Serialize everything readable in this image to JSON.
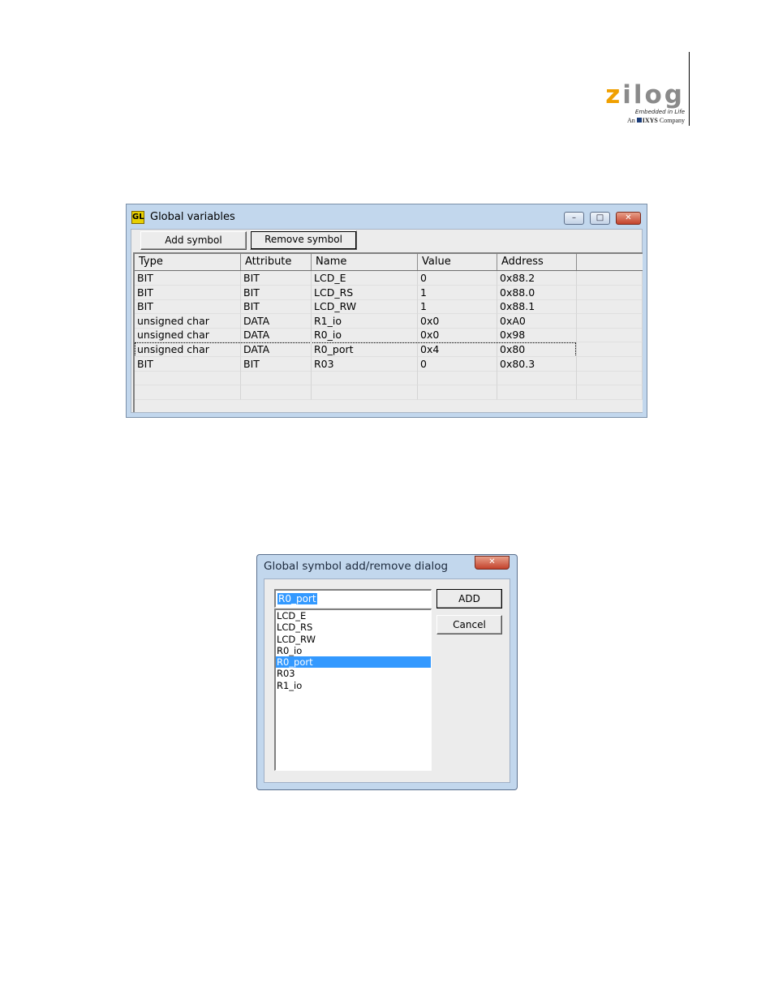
{
  "logo": {
    "brand": "zilog",
    "tagline": "Embedded in Life",
    "company_prefix": "An",
    "company_name": "IXYS",
    "company_suffix": "Company",
    "brand_colors": {
      "accent": "#f0a000",
      "gray": "#8a8a8a"
    }
  },
  "global_variables": {
    "title": "Global variables",
    "app_icon_text": "GL",
    "caption_icons": [
      "minimize-icon",
      "maximize-icon",
      "close-icon"
    ],
    "toolbar": {
      "add_label": "Add symbol",
      "remove_label": "Remove symbol"
    },
    "columns": [
      "Type",
      "Attribute",
      "Name",
      "Value",
      "Address"
    ],
    "rows": [
      [
        "BIT",
        "BIT",
        "LCD_E",
        "0",
        "0x88.2"
      ],
      [
        "BIT",
        "BIT",
        "LCD_RS",
        "1",
        "0x88.0"
      ],
      [
        "BIT",
        "BIT",
        "LCD_RW",
        "1",
        "0x88.1"
      ],
      [
        "unsigned char",
        "DATA",
        "R1_io",
        "0x0",
        "0xA0"
      ],
      [
        "unsigned char",
        "DATA",
        "R0_io",
        "0x0",
        "0x98"
      ],
      [
        "unsigned char",
        "DATA",
        "R0_port",
        "0x4",
        "0x80"
      ],
      [
        "BIT",
        "BIT",
        "R03",
        "0",
        "0x80.3"
      ]
    ],
    "focused_row": 5
  },
  "dialog": {
    "title": "Global symbol add/remove dialog",
    "input_value": "R0_port",
    "add_label": "ADD",
    "cancel_label": "Cancel",
    "list_items": [
      "LCD_E",
      "LCD_RS",
      "LCD_RW",
      "R0_io",
      "R0_port",
      "R03",
      "R1_io"
    ],
    "selected_item": "R0_port"
  }
}
